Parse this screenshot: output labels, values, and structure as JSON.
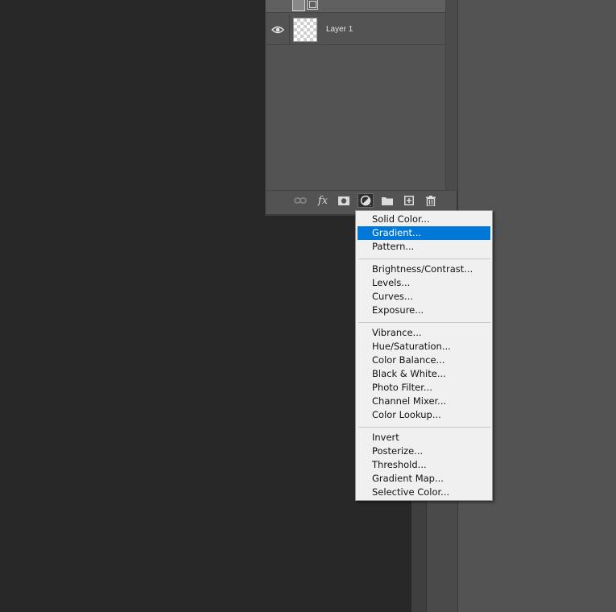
{
  "layers_panel": {
    "layers": [
      {
        "name": "Layer 1",
        "visible": true
      }
    ],
    "toolbar": {
      "buttons": [
        {
          "id": "link",
          "icon": "link-icon"
        },
        {
          "id": "fx",
          "label": "fx"
        },
        {
          "id": "mask",
          "icon": "layer-mask-icon"
        },
        {
          "id": "adjustment",
          "icon": "adjustment-layer-icon",
          "active": true
        },
        {
          "id": "group",
          "icon": "folder-icon"
        },
        {
          "id": "new",
          "icon": "new-layer-icon"
        },
        {
          "id": "delete",
          "icon": "trash-icon"
        }
      ]
    }
  },
  "adjustment_menu": {
    "highlight_color": "#0078d7",
    "groups": [
      [
        "Solid Color...",
        "Gradient...",
        "Pattern..."
      ],
      [
        "Brightness/Contrast...",
        "Levels...",
        "Curves...",
        "Exposure..."
      ],
      [
        "Vibrance...",
        "Hue/Saturation...",
        "Color Balance...",
        "Black & White...",
        "Photo Filter...",
        "Channel Mixer...",
        "Color Lookup..."
      ],
      [
        "Invert",
        "Posterize...",
        "Threshold...",
        "Gradient Map...",
        "Selective Color..."
      ]
    ],
    "highlighted": "Gradient..."
  }
}
